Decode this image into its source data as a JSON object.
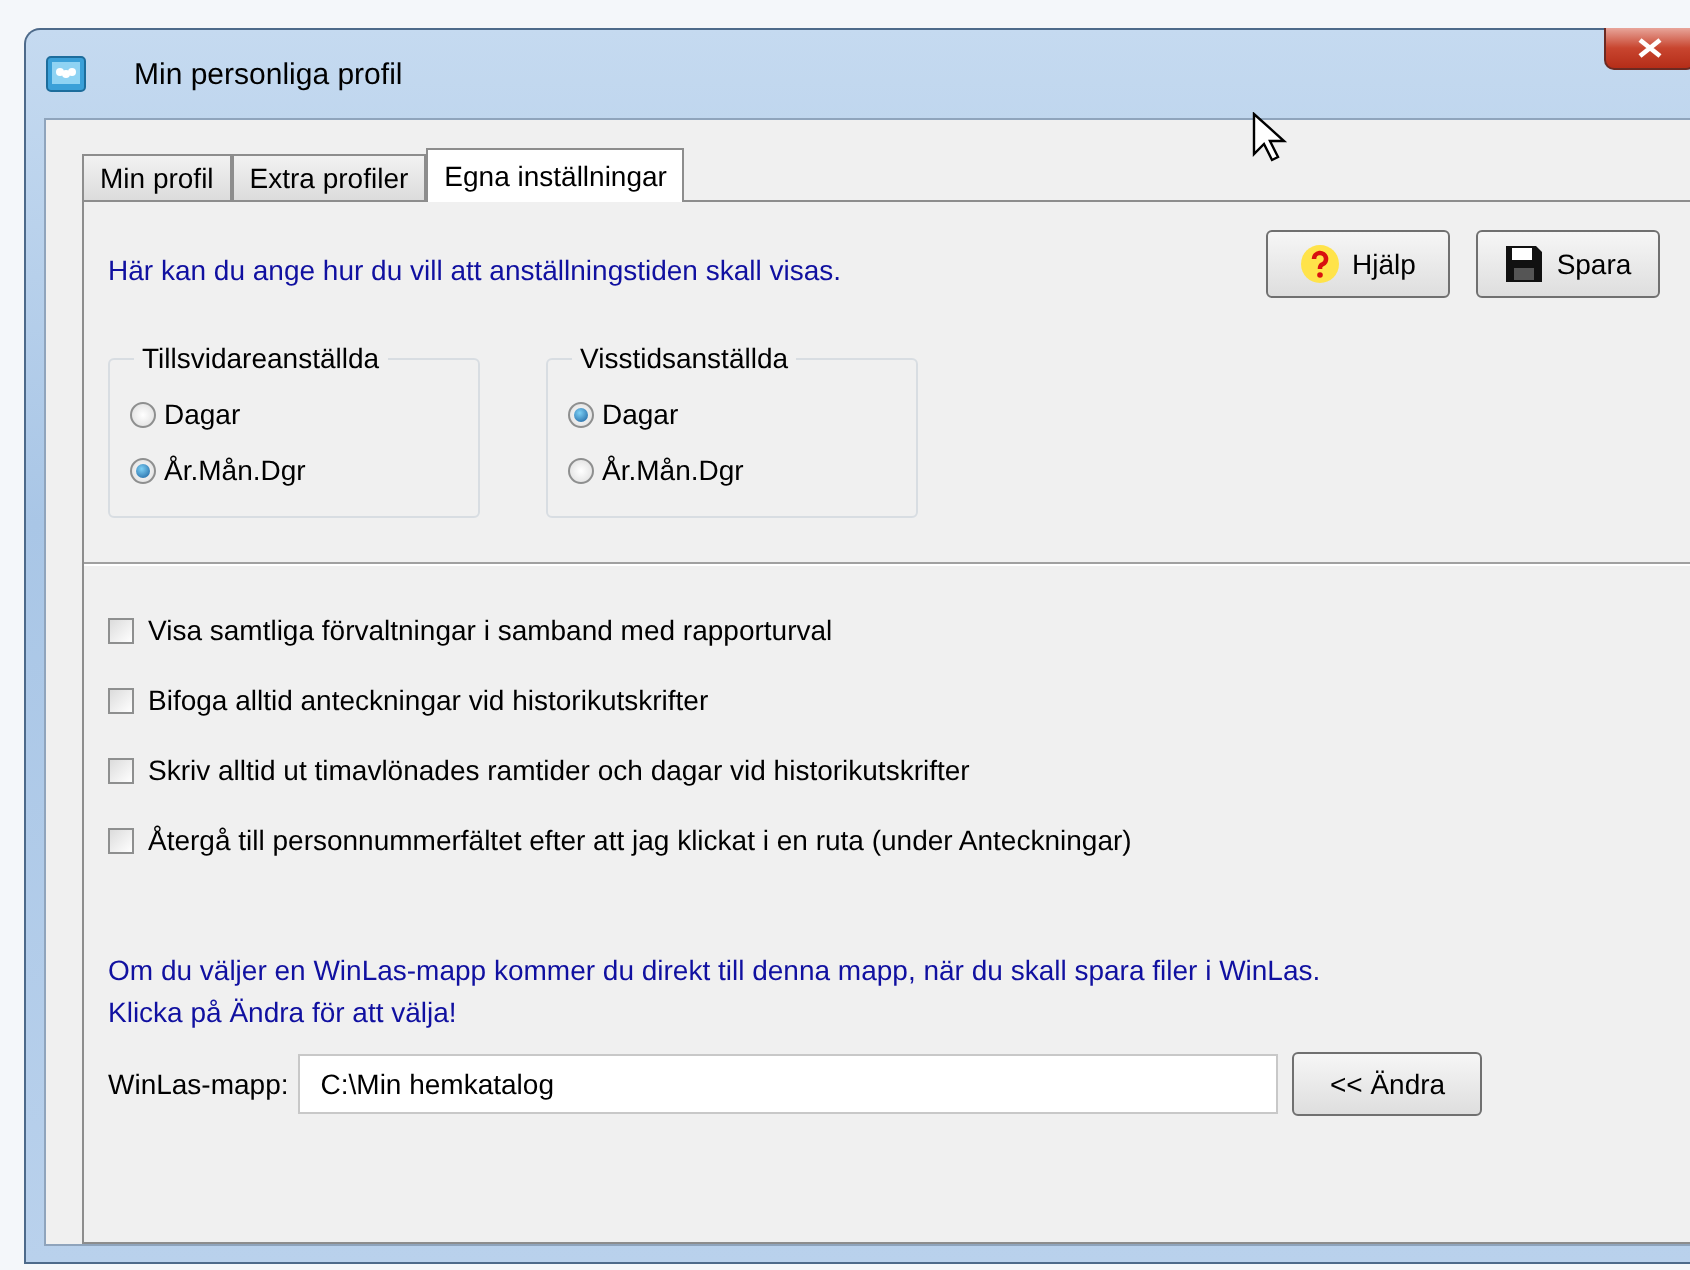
{
  "window": {
    "title": "Min personliga profil"
  },
  "tabs": [
    {
      "label": "Min profil",
      "selected": false
    },
    {
      "label": "Extra profiler",
      "selected": false
    },
    {
      "label": "Egna inställningar",
      "selected": true
    }
  ],
  "intro": "Här kan du ange hur du vill att anställningstiden skall visas.",
  "buttons": [
    {
      "kind": "help",
      "label": "Hjälp"
    },
    {
      "kind": "save",
      "label": "Spara"
    }
  ],
  "groups": [
    {
      "title": "Tillsvidareanställda",
      "options": [
        {
          "label": "Dagar",
          "selected": false
        },
        {
          "label": "År.Mån.Dgr",
          "selected": true
        }
      ]
    },
    {
      "title": "Visstidsanställda",
      "options": [
        {
          "label": "Dagar",
          "selected": true
        },
        {
          "label": "År.Mån.Dgr",
          "selected": false
        }
      ]
    }
  ],
  "checkboxes": [
    {
      "label": "Visa samtliga förvaltningar i samband med rapporturval",
      "checked": false
    },
    {
      "label": "Bifoga alltid anteckningar vid historikutskrifter",
      "checked": false
    },
    {
      "label": "Skriv alltid ut timavlönades ramtider och dagar vid historikutskrifter",
      "checked": false
    },
    {
      "label": "Återgå till personnummerfältet efter att jag klickat i en ruta (under Anteckningar)",
      "checked": false
    }
  ],
  "folder_info": [
    "Om du väljer en WinLas-mapp kommer du direkt till denna mapp, när du skall spara filer i WinLas.",
    "Klicka på Ändra för att välja!"
  ],
  "folder": {
    "label": "WinLas-mapp:",
    "value": "C:\\Min hemkatalog",
    "button": "<< Ändra"
  }
}
